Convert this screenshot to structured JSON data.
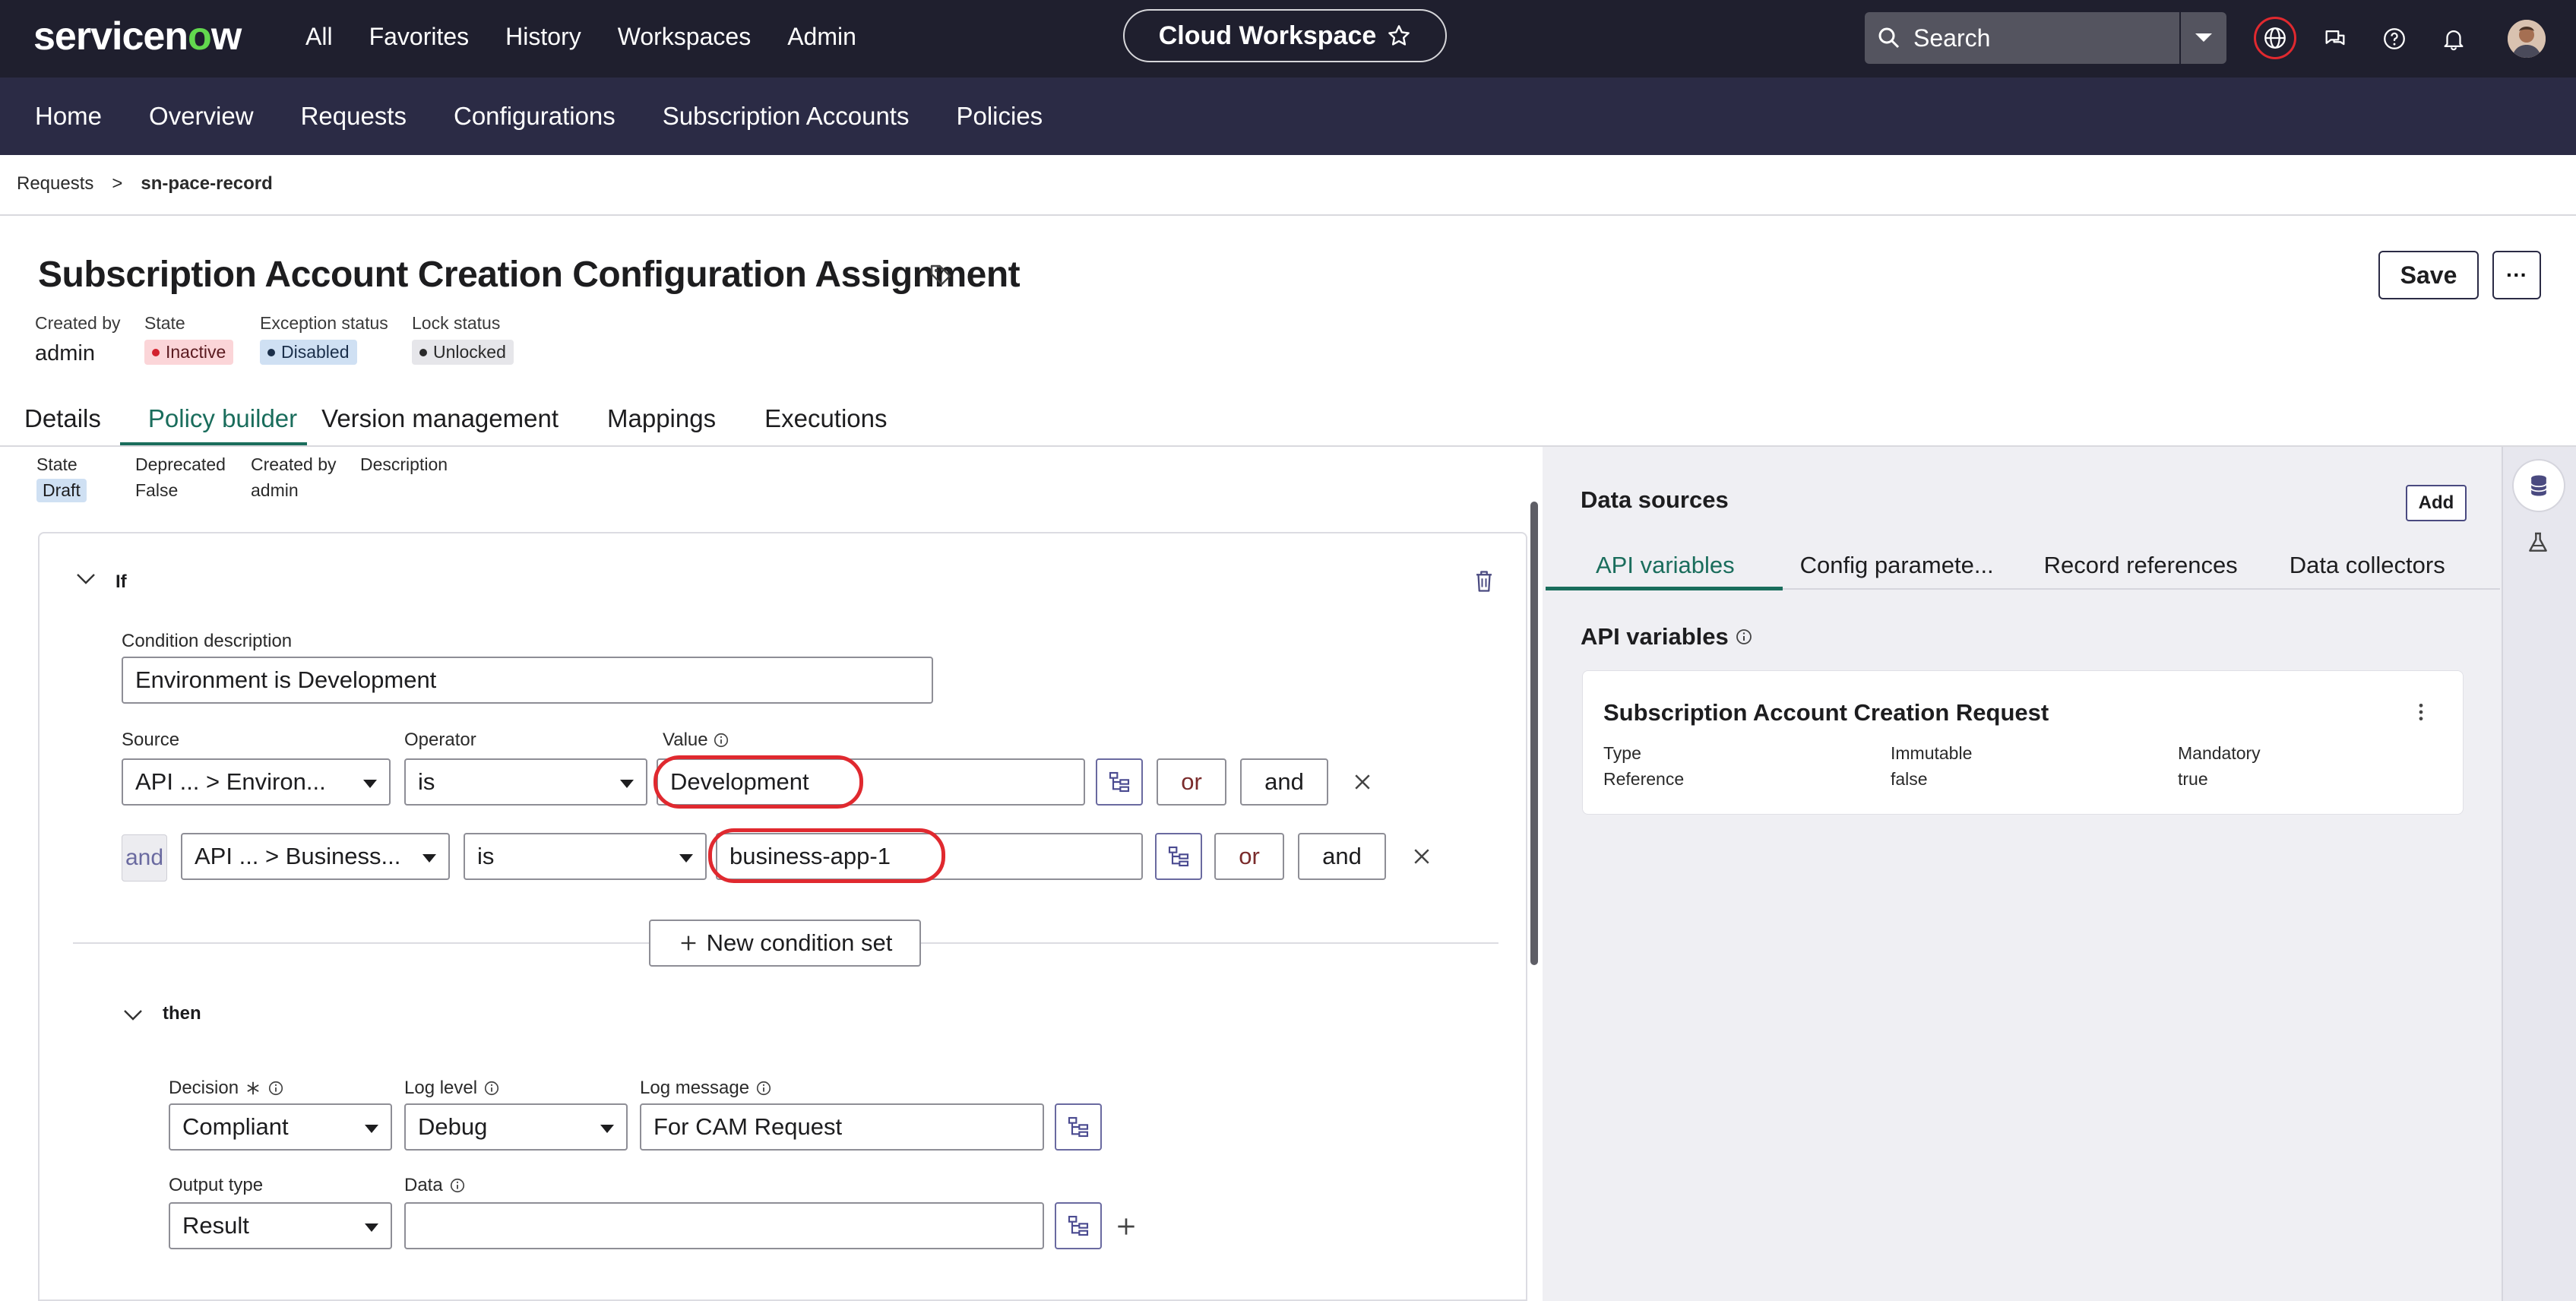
{
  "topbar": {
    "logo_a": "servicen",
    "logo_o": "o",
    "logo_b": "w",
    "nav": [
      "All",
      "Favorites",
      "History",
      "Workspaces",
      "Admin"
    ],
    "workspace_label": "Cloud Workspace",
    "search_placeholder": "Search"
  },
  "subnav": {
    "items": [
      "Home",
      "Overview",
      "Requests",
      "Configurations",
      "Subscription Accounts",
      "Policies"
    ]
  },
  "breadcrumb": {
    "parent": "Requests",
    "separator": ">",
    "current": "sn-pace-record"
  },
  "record": {
    "title": "Subscription Account Creation Configuration Assignment",
    "save_label": "Save",
    "more_label": "···",
    "created_by_label": "Created by",
    "created_by": "admin",
    "state_label": "State",
    "state": "Inactive",
    "exception_label": "Exception status",
    "exception": "Disabled",
    "lock_label": "Lock status",
    "lock": "Unlocked"
  },
  "tabs": [
    "Details",
    "Policy builder",
    "Version management",
    "Mappings",
    "Executions"
  ],
  "policy": {
    "state_label": "State",
    "state": "Draft",
    "deprecated_label": "Deprecated",
    "deprecated": "False",
    "created_by_label": "Created by",
    "created_by": "admin",
    "description_label": "Description",
    "if_label": "If",
    "condition_desc_label": "Condition description",
    "condition_desc": "Environment is Development",
    "source_label": "Source",
    "operator_label": "Operator",
    "value_label": "Value",
    "row1": {
      "source": "API ... > Environ...",
      "operator": "is",
      "value": "Development"
    },
    "row2": {
      "connector": "and",
      "source": "API ... > Business...",
      "operator": "is",
      "value": "business-app-1"
    },
    "or_label": "or",
    "and_label": "and",
    "new_condition_set": "New condition set",
    "then_label": "then",
    "decision_label": "Decision",
    "decision": "Compliant",
    "log_level_label": "Log level",
    "log_level": "Debug",
    "log_message_label": "Log message",
    "log_message": "For CAM Request",
    "output_type_label": "Output type",
    "output_type": "Result",
    "data_label": "Data",
    "data_value": ""
  },
  "datasources": {
    "title": "Data sources",
    "add_label": "Add",
    "tabs": [
      "API variables",
      "Config paramete...",
      "Record references",
      "Data collectors"
    ],
    "section_title": "API variables",
    "card": {
      "title": "Subscription Account Creation Request",
      "type_label": "Type",
      "type": "Reference",
      "immutable_label": "Immutable",
      "immutable": "false",
      "mandatory_label": "Mandatory",
      "mandatory": "true"
    }
  },
  "colors": {
    "topbar": "#1f1f2e",
    "subnav": "#2b2b45",
    "accent": "#1a6d5c",
    "highlight": "#e0292f",
    "logo_o": "#62d84e"
  }
}
